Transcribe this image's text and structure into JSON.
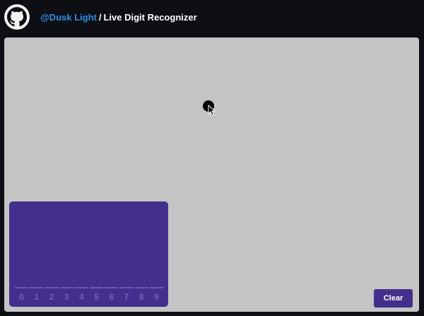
{
  "header": {
    "user_link": "@Dusk Light",
    "separator": "/",
    "app_title": "Live Digit Recognizer"
  },
  "prediction": {
    "digits": [
      "0",
      "1",
      "2",
      "3",
      "4",
      "5",
      "6",
      "7",
      "8",
      "9"
    ],
    "probabilities": [
      0,
      0,
      0,
      0,
      0,
      0,
      0,
      0,
      0,
      0
    ]
  },
  "controls": {
    "clear_label": "Clear"
  },
  "icons": {
    "logo": "github-icon",
    "cursor": "mouse-pointer-icon"
  },
  "colors": {
    "accent": "#432f8c",
    "link": "#2e8fe6",
    "canvas": "#c4c4c4",
    "background": "#0d0f14"
  }
}
